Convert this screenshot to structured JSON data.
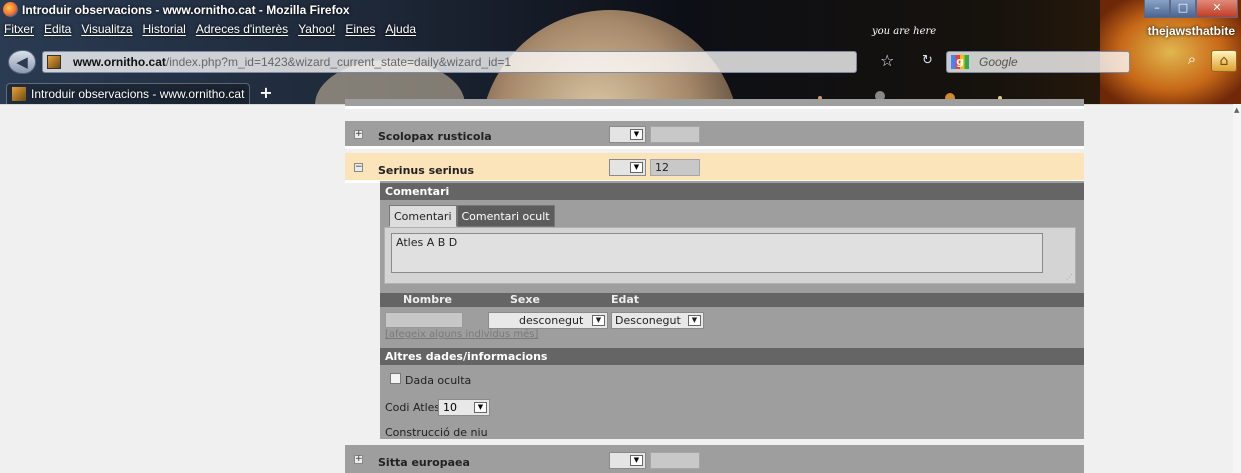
{
  "window": {
    "title": "Introduir observacions - www.ornitho.cat - Mozilla Firefox",
    "profile_label": "thejawsthatbite"
  },
  "menu": [
    "Fitxer",
    "Edita",
    "Visualitza",
    "Historial",
    "Adreces d'interès",
    "Yahoo!",
    "Eines",
    "Ajuda"
  ],
  "navbar": {
    "url_domain": "www.ornitho.cat",
    "url_path": "/index.php?m_id=1423&wizard_current_state=daily&wizard_id=1",
    "search_placeholder": "Google",
    "you_are_here": "you are here"
  },
  "tab": {
    "label": "Introduir observacions - www.ornitho.cat"
  },
  "species_rows": [
    {
      "name": "Scolopax rusticola",
      "toggle": "+",
      "quantity": ""
    },
    {
      "name": "Serinus serinus",
      "toggle": "−",
      "quantity": "12"
    },
    {
      "name": "Sitta europaea",
      "toggle": "+",
      "quantity": ""
    }
  ],
  "detail": {
    "comment_header": "Comentari",
    "tabs": [
      "Comentari",
      "Comentari ocult"
    ],
    "comment_text": "Atles A B D",
    "columns": [
      "Nombre",
      "Sexe",
      "Edat"
    ],
    "sexe_value": "desconegut",
    "edat_value": "Desconegut",
    "add_link": "[afegeix alguns individus més]",
    "other_header": "Altres dades/informacions",
    "hidden_label": "Dada oculta",
    "codi_label": "Codi Atles",
    "codi_value": "10",
    "niu_label": "Construcció de niu"
  }
}
